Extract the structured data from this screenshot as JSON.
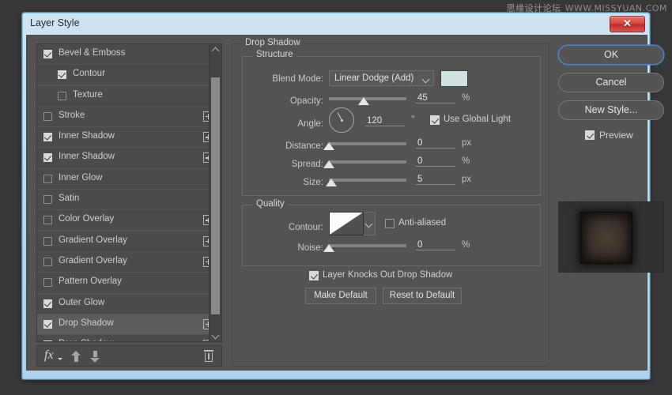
{
  "watermark": {
    "cn": "思缘设计论坛",
    "url": "WWW.MISSYUAN.COM"
  },
  "window": {
    "title": "Layer Style",
    "close_label": "✕"
  },
  "effects_list": {
    "items": [
      {
        "label": "Bevel & Emboss",
        "checked": true,
        "sub": false,
        "plus": false,
        "selected": false
      },
      {
        "label": "Contour",
        "checked": true,
        "sub": true,
        "plus": false,
        "selected": false
      },
      {
        "label": "Texture",
        "checked": false,
        "sub": true,
        "plus": false,
        "selected": false
      },
      {
        "label": "Stroke",
        "checked": false,
        "sub": false,
        "plus": true,
        "selected": false
      },
      {
        "label": "Inner Shadow",
        "checked": true,
        "sub": false,
        "plus": true,
        "selected": false
      },
      {
        "label": "Inner Shadow",
        "checked": true,
        "sub": false,
        "plus": true,
        "selected": false
      },
      {
        "label": "Inner Glow",
        "checked": false,
        "sub": false,
        "plus": false,
        "selected": false
      },
      {
        "label": "Satin",
        "checked": false,
        "sub": false,
        "plus": false,
        "selected": false
      },
      {
        "label": "Color Overlay",
        "checked": false,
        "sub": false,
        "plus": true,
        "selected": false
      },
      {
        "label": "Gradient Overlay",
        "checked": false,
        "sub": false,
        "plus": true,
        "selected": false
      },
      {
        "label": "Gradient Overlay",
        "checked": false,
        "sub": false,
        "plus": true,
        "selected": false
      },
      {
        "label": "Pattern Overlay",
        "checked": false,
        "sub": false,
        "plus": false,
        "selected": false
      },
      {
        "label": "Outer Glow",
        "checked": true,
        "sub": false,
        "plus": false,
        "selected": false
      },
      {
        "label": "Drop Shadow",
        "checked": true,
        "sub": false,
        "plus": true,
        "selected": true
      },
      {
        "label": "Drop Shadow",
        "checked": true,
        "sub": false,
        "plus": true,
        "selected": false
      }
    ],
    "toolbar": {
      "fx_label": "fx",
      "move_up": "move-up",
      "move_down": "move-down",
      "delete": "delete"
    }
  },
  "settings": {
    "panel_title": "Drop Shadow",
    "structure": {
      "title": "Structure",
      "blend_mode_label": "Blend Mode:",
      "blend_mode_value": "Linear Dodge (Add)",
      "color_swatch": "#cfe1e0",
      "opacity_label": "Opacity:",
      "opacity_value": "45",
      "opacity_unit": "%",
      "opacity_percent": 45,
      "angle_label": "Angle:",
      "angle_value": "120",
      "angle_unit": "°",
      "angle_degrees": 120,
      "use_global_light_label": "Use Global Light",
      "use_global_light_checked": true,
      "distance_label": "Distance:",
      "distance_value": "0",
      "distance_unit": "px",
      "distance_percent": 0,
      "spread_label": "Spread:",
      "spread_value": "0",
      "spread_unit": "%",
      "spread_percent": 0,
      "size_label": "Size:",
      "size_value": "5",
      "size_unit": "px",
      "size_percent": 3
    },
    "quality": {
      "title": "Quality",
      "contour_label": "Contour:",
      "anti_aliased_label": "Anti-aliased",
      "anti_aliased_checked": false,
      "noise_label": "Noise:",
      "noise_value": "0",
      "noise_unit": "%",
      "noise_percent": 0
    },
    "knockout": {
      "label": "Layer Knocks Out Drop Shadow",
      "checked": true
    },
    "make_default_label": "Make Default",
    "reset_default_label": "Reset to Default"
  },
  "actions": {
    "ok_label": "OK",
    "cancel_label": "Cancel",
    "new_style_label": "New Style...",
    "preview_label": "Preview",
    "preview_checked": true
  }
}
